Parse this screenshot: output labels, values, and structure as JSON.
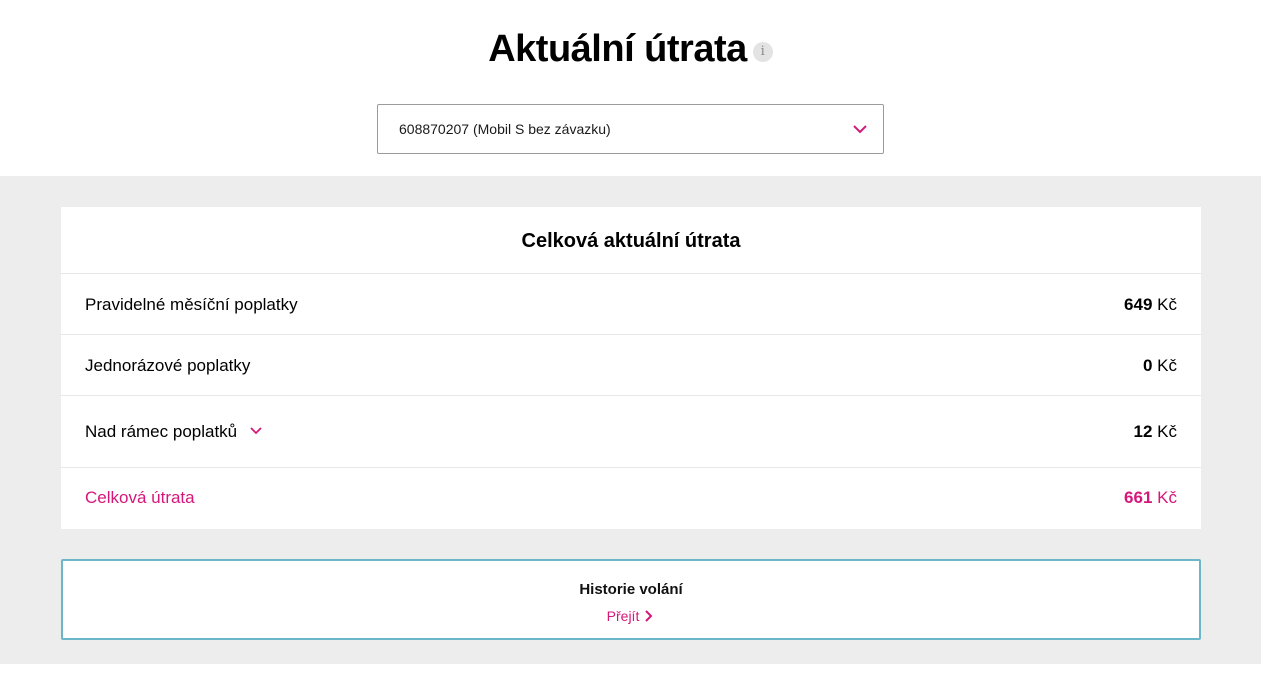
{
  "header": {
    "title": "Aktuální útrata",
    "info_icon": "info-icon",
    "info_glyph": "i"
  },
  "selector": {
    "value": "608870207 (Mobil S bez závazku)",
    "icon": "chevron-down-icon"
  },
  "summary": {
    "title": "Celková aktuální útrata",
    "currency": "Kč",
    "rows": [
      {
        "label": "Pravidelné měsíční poplatky",
        "amount": "649"
      },
      {
        "label": "Jednorázové poplatky",
        "amount": "0"
      },
      {
        "label": "Nad rámec poplatků",
        "amount": "12",
        "expandable": true
      },
      {
        "label": "Celková útrata",
        "amount": "661",
        "highlight": true
      }
    ]
  },
  "history": {
    "title": "Historie volání",
    "link": "Přejít",
    "icon": "chevron-right-icon"
  },
  "colors": {
    "accent": "#d6177a",
    "band": "#ededed",
    "history_border": "#6bb6c9"
  }
}
